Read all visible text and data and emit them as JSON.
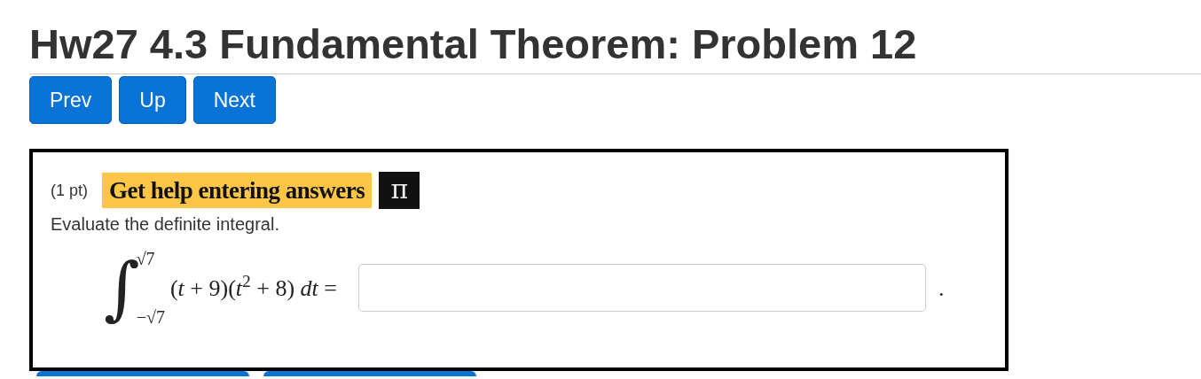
{
  "title": "Hw27 4.3 Fundamental Theorem: Problem 12",
  "nav_buttons": [
    "Prev",
    "Up",
    "Next"
  ],
  "problem": {
    "points": "(1 pt)",
    "help_link": "Get help entering answers",
    "help_icon": "π",
    "prompt": "Evaluate the definite integral.",
    "integral_sign": "∫",
    "upper_limit": "√7",
    "lower_limit": "−√7",
    "integrand": "(*t* + 9)(*t*$^{2}$ + 8) *dt* =",
    "trailing": "."
  }
}
